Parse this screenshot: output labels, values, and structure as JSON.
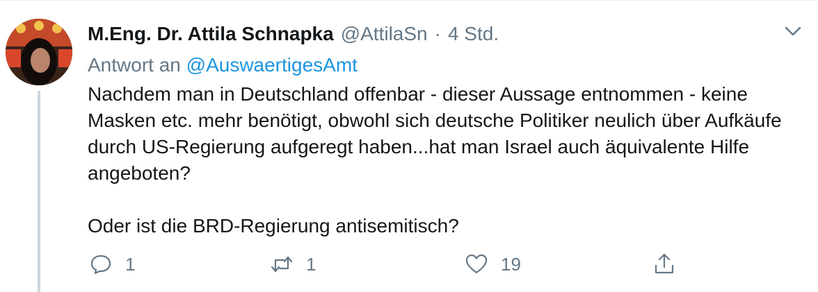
{
  "tweet": {
    "author_name": "M.Eng. Dr. Attila Schnapka",
    "author_handle": "@AttilaSn",
    "separator": "·",
    "time": "4 Std.",
    "reply_prefix": "Antwort an",
    "reply_to": "@AuswaertigesAmt",
    "text_paragraph_1": "Nachdem man in Deutschland offenbar - dieser Aussage entnommen - keine Masken etc. mehr benötigt, obwohl sich deutsche Politiker neulich über Aufkäufe durch US-Regierung aufgeregt haben...hat man Israel auch äquivalente Hilfe angeboten?",
    "text_paragraph_2": "Oder ist die BRD-Regierung antisemitisch?"
  },
  "actions": {
    "reply_count": "1",
    "retweet_count": "1",
    "like_count": "19"
  },
  "icons": {
    "reply": "comment-bubble-icon",
    "retweet": "retweet-arrows-icon",
    "like": "heart-icon",
    "share": "share-upload-icon",
    "more": "chevron-down-icon"
  },
  "colors": {
    "text": "#14171a",
    "secondary": "#657786",
    "link": "#1b95e0",
    "thread_line": "#ccd6dd"
  }
}
